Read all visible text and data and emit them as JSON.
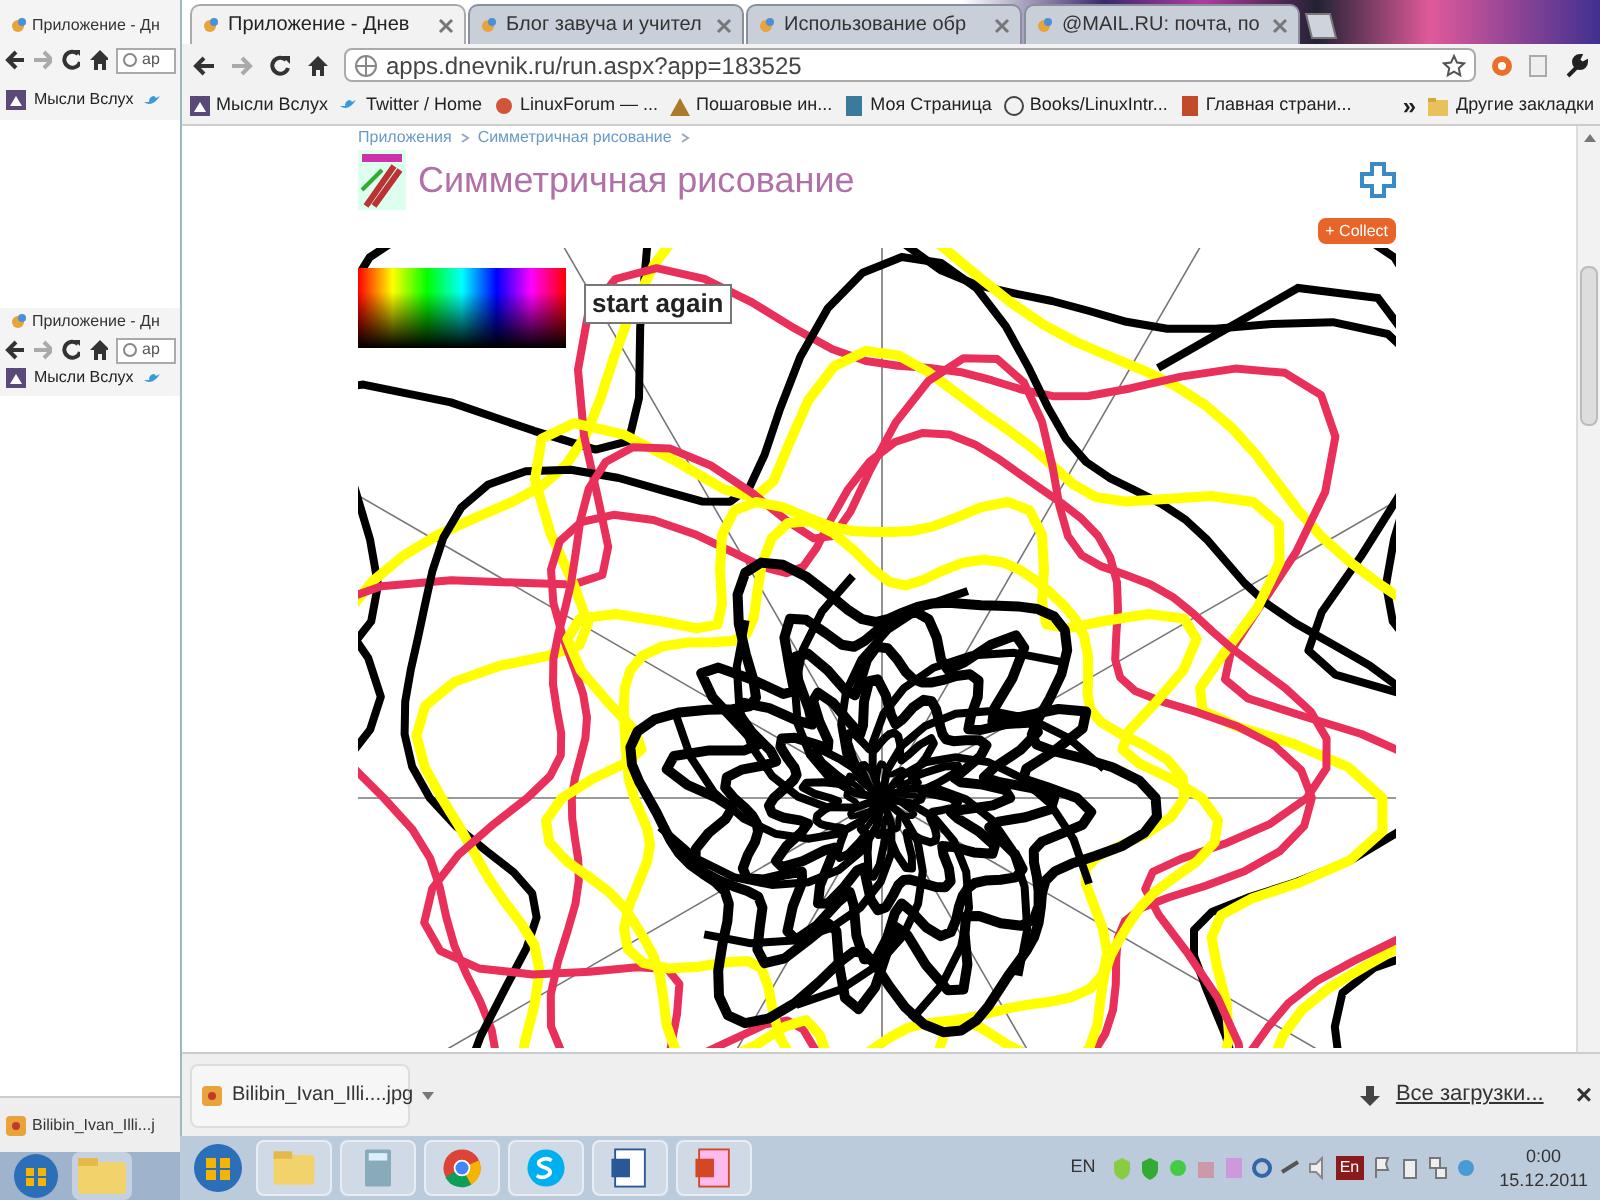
{
  "back_windows": [
    {
      "tab": "Приложение - Дн",
      "address": "ap",
      "bookmark": "Мысли Вслух"
    },
    {
      "tab": "Приложение - Дн",
      "address": "ap",
      "bookmark": "Мысли Вслух"
    }
  ],
  "back_download": {
    "file": "Bilibin_Ivan_Illi...j"
  },
  "tabs": [
    {
      "label": "Приложение - Днев",
      "selected": true
    },
    {
      "label": "Блог завуча и учител",
      "selected": false
    },
    {
      "label": "Использование обр",
      "selected": false
    },
    {
      "label": "@MAIL.RU: почта, по",
      "selected": false
    }
  ],
  "address": "apps.dnevnik.ru/run.aspx?app=183525",
  "bookmarks": [
    "Мысли Вслух",
    "Twitter / Home",
    "LinuxForum — ...",
    "Пошаговые ин...",
    "Моя Страница",
    "Books/LinuxIntr...",
    "Главная страни..."
  ],
  "more_bookmarks": "»",
  "other_bookmarks": "Другие закладки",
  "page": {
    "breadcrumb": [
      "Приложения",
      "Симметричная рисование"
    ],
    "title": "Симметричная рисование",
    "collect_button": "+ Collect",
    "start_button": "start again"
  },
  "download_bar": {
    "file": "Bilibin_Ivan_Illi....jpg",
    "all_downloads": "Все загрузки...",
    "close": "×"
  },
  "taskbar": {
    "language": "EN",
    "tray_badge": "En",
    "time": "0:00",
    "date": "15.12.2011"
  }
}
